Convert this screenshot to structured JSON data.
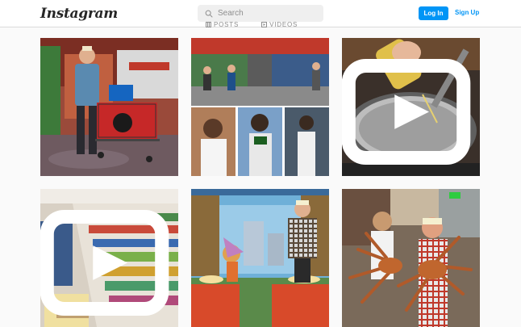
{
  "header": {
    "logo_text": "Instagram",
    "search_placeholder": "Search",
    "login_label": "Log In",
    "signup_label": "Sign Up"
  },
  "tabs": [
    {
      "label": "POSTS",
      "icon": "grid-icon"
    },
    {
      "label": "VIDEOS",
      "icon": "video-icon"
    }
  ],
  "colors": {
    "accent": "#0095f6",
    "background": "#fafafa",
    "search_bg": "#efefef"
  },
  "posts": [
    {
      "id": "post-1",
      "subject": "grocery-show-host-cart"
    },
    {
      "id": "post-2",
      "subject": "grocery-aisle-baseball-collage"
    },
    {
      "id": "post-3",
      "subject": "oil-into-pan"
    },
    {
      "id": "post-4",
      "subject": "grocery-aisle-shelves"
    },
    {
      "id": "post-5",
      "subject": "cartoon-kitchen-host"
    },
    {
      "id": "post-6",
      "subject": "crab-legs-kitchen"
    }
  ]
}
